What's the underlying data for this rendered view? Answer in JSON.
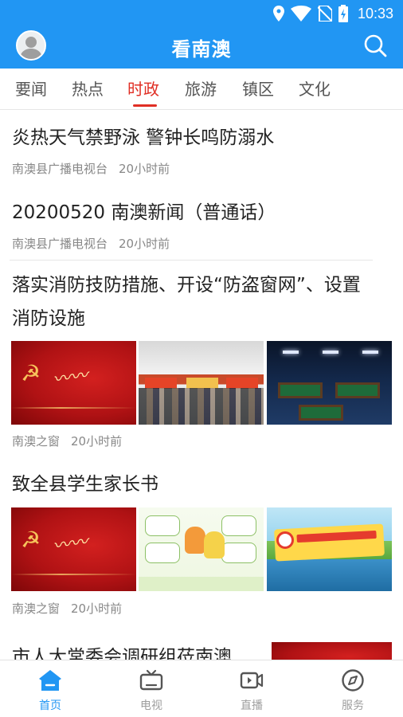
{
  "status_bar": {
    "time": "10:33",
    "icons": [
      "location-icon",
      "wifi-icon",
      "no-sim-icon",
      "battery-charging-icon"
    ]
  },
  "app_bar": {
    "title": "看南澳",
    "avatar_icon": "user-avatar-icon",
    "search_icon": "search-icon"
  },
  "tabs": {
    "items": [
      {
        "label": "要闻"
      },
      {
        "label": "热点"
      },
      {
        "label": "时政"
      },
      {
        "label": "旅游"
      },
      {
        "label": "镇区"
      },
      {
        "label": "文化"
      }
    ],
    "active": "时政"
  },
  "feed": {
    "items": [
      {
        "title": "炎热天气禁野泳 警钟长鸣防溺水",
        "source": "南澳县广播电视台",
        "time": "20小时前"
      },
      {
        "title": "20200520 南澳新闻（普通话）",
        "source": "南澳县广播电视台",
        "time": "20小时前"
      },
      {
        "title_line1": "落实消防技防措施、开设“防盗窗网”、设置",
        "title_line2": "消防设施",
        "source": "南澳之窗",
        "time": "20小时前"
      },
      {
        "title": "致全县学生家长书",
        "source": "南澳之窗",
        "time": "20小时前"
      },
      {
        "title": "市人大常委会调研组莅南澳"
      }
    ]
  },
  "bottom_nav": {
    "items": [
      {
        "label": "首页",
        "icon": "home-icon"
      },
      {
        "label": "电视",
        "icon": "tv-icon"
      },
      {
        "label": "直播",
        "icon": "live-video-icon"
      },
      {
        "label": "服务",
        "icon": "compass-icon"
      }
    ],
    "active": "首页"
  },
  "colors": {
    "header_blue": "#2196f3",
    "active_tab_red": "#e02e24",
    "active_nav_blue": "#2196f3",
    "meta_gray": "#888888"
  }
}
